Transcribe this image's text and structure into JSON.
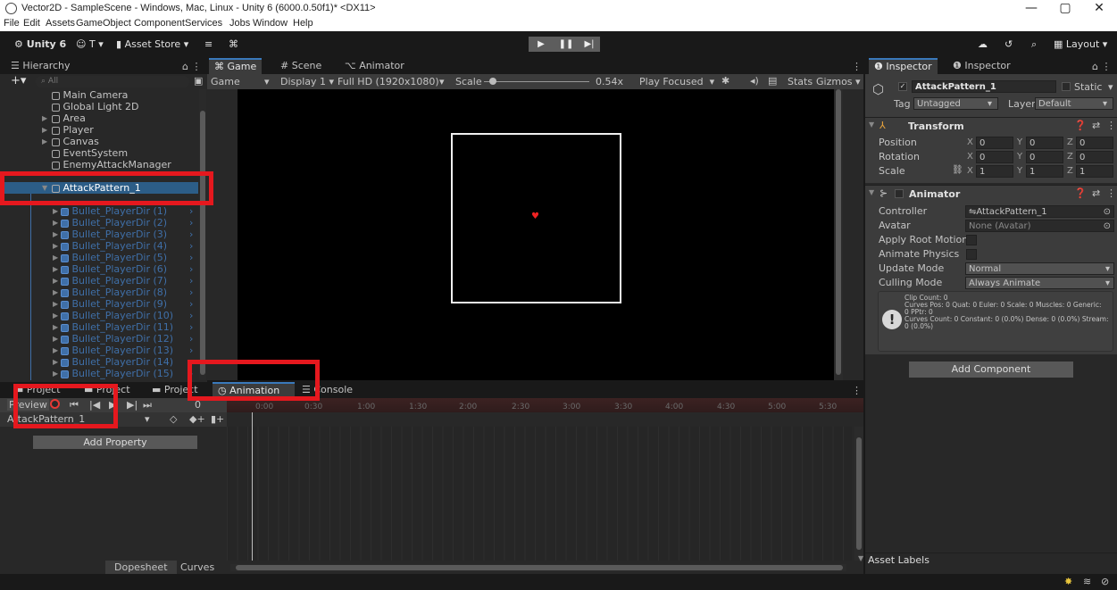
{
  "window": {
    "title": "Vector2D - SampleScene - Windows, Mac, Linux - Unity 6 (6000.0.50f1)* <DX11>",
    "min": "—",
    "max": "▢",
    "close": "✕"
  },
  "menu": [
    "File",
    "Edit",
    "Assets",
    "GameObject",
    "Component",
    "Services",
    "Jobs",
    "Window",
    "Help"
  ],
  "toolbar": {
    "unity": "Unity 6",
    "account": "T",
    "asset_store": "Asset Store",
    "layout": "Layout"
  },
  "hierarchy": {
    "tab": "Hierarchy",
    "search_placeholder": "All",
    "items": [
      {
        "label": "Main Camera"
      },
      {
        "label": "Global Light 2D"
      },
      {
        "label": "Area"
      },
      {
        "label": "Player"
      },
      {
        "label": "Canvas"
      },
      {
        "label": "EventSystem"
      },
      {
        "label": "EnemyAttackManager"
      },
      {
        "label": "AttackPattern_1"
      },
      {
        "label": "Bullet_PlayerDir (1)"
      },
      {
        "label": "Bullet_PlayerDir (2)"
      },
      {
        "label": "Bullet_PlayerDir (3)"
      },
      {
        "label": "Bullet_PlayerDir (4)"
      },
      {
        "label": "Bullet_PlayerDir (5)"
      },
      {
        "label": "Bullet_PlayerDir (6)"
      },
      {
        "label": "Bullet_PlayerDir (7)"
      },
      {
        "label": "Bullet_PlayerDir (8)"
      },
      {
        "label": "Bullet_PlayerDir (9)"
      },
      {
        "label": "Bullet_PlayerDir (10)"
      },
      {
        "label": "Bullet_PlayerDir (11)"
      },
      {
        "label": "Bullet_PlayerDir (12)"
      },
      {
        "label": "Bullet_PlayerDir (13)"
      },
      {
        "label": "Bullet_PlayerDir (14)"
      },
      {
        "label": "Bullet_PlayerDir (15)"
      }
    ]
  },
  "center_tabs": {
    "game": "Game",
    "scene": "Scene",
    "animator": "Animator"
  },
  "game_bar": {
    "mode": "Game",
    "display": "Display 1",
    "resolution": "Full HD (1920x1080)",
    "scale_label": "Scale",
    "scale_value": "0.54x",
    "play_focused": "Play Focused",
    "stats": "Stats",
    "gizmos": "Gizmos"
  },
  "bottom_tabs": {
    "project1": "Project",
    "project2": "Project",
    "project3": "Project",
    "animation": "Animation",
    "console": "Console"
  },
  "animation": {
    "preview": "Preview",
    "clip": "AttackPattern_1",
    "frame": "0",
    "add_property": "Add Property",
    "dopesheet": "Dopesheet",
    "curves": "Curves",
    "ticks": [
      "0:00",
      "0:30",
      "1:00",
      "1:30",
      "2:00",
      "2:30",
      "3:00",
      "3:30",
      "4:00",
      "4:30",
      "5:00",
      "5:30"
    ]
  },
  "inspector": {
    "tab1": "Inspector",
    "tab2": "Inspector",
    "object_name": "AttackPattern_1",
    "static": "Static",
    "tag_label": "Tag",
    "tag_value": "Untagged",
    "layer_label": "Layer",
    "layer_value": "Default",
    "transform": {
      "title": "Transform",
      "position_label": "Position",
      "rotation_label": "Rotation",
      "scale_label": "Scale",
      "position": [
        "0",
        "0",
        "0"
      ],
      "rotation": [
        "0",
        "0",
        "0"
      ],
      "scale": [
        "1",
        "1",
        "1"
      ]
    },
    "animator": {
      "title": "Animator",
      "controller_label": "Controller",
      "controller_value": "AttackPattern_1",
      "avatar_label": "Avatar",
      "avatar_value": "None (Avatar)",
      "root_motion_label": "Apply Root Motion",
      "animate_physics_label": "Animate Physics",
      "update_mode_label": "Update Mode",
      "update_mode_value": "Normal",
      "culling_mode_label": "Culling Mode",
      "culling_mode_value": "Always Animate",
      "info": [
        "Clip Count: 0",
        "Curves Pos: 0 Quat: 0 Euler: 0 Scale: 0 Muscles: 0 Generic:",
        "0 PPtr: 0",
        "Curves Count: 0 Constant: 0 (0.0%) Dense: 0 (0.0%) Stream:",
        "0 (0.0%)"
      ]
    },
    "add_component": "Add Component",
    "asset_labels": "Asset Labels"
  },
  "colors": {
    "accent": "#3a79bb",
    "highlight_box": "#e5181e",
    "prefab_blue": "#3f6fa8",
    "record_red": "#e53935"
  }
}
